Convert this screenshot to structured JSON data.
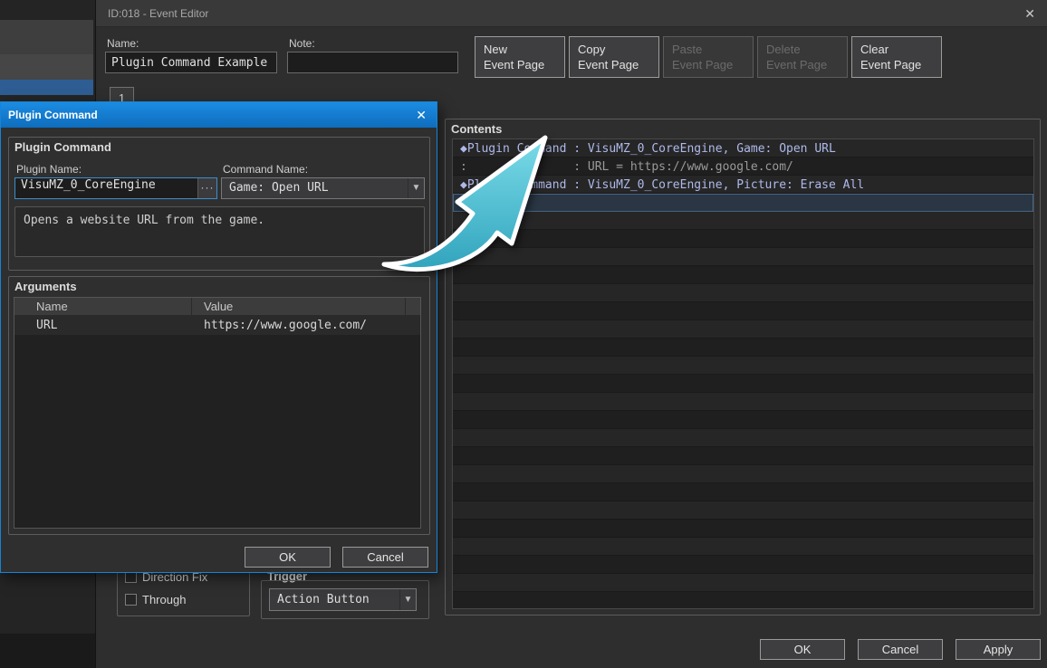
{
  "window": {
    "title": "ID:018 - Event Editor",
    "close_glyph": "✕"
  },
  "header": {
    "name_label": "Name:",
    "name_value": "Plugin Command Example",
    "note_label": "Note:",
    "note_value": "",
    "page_tab": "1",
    "page_buttons": [
      {
        "line1": "New",
        "line2": "Event Page",
        "enabled": true
      },
      {
        "line1": "Copy",
        "line2": "Event Page",
        "enabled": true
      },
      {
        "line1": "Paste",
        "line2": "Event Page",
        "enabled": false
      },
      {
        "line1": "Delete",
        "line2": "Event Page",
        "enabled": false
      },
      {
        "line1": "Clear",
        "line2": "Event Page",
        "enabled": true
      }
    ]
  },
  "dialog": {
    "title": "Plugin Command",
    "close_glyph": "✕",
    "plugin_group": {
      "title": "Plugin Command",
      "plugin_name_label": "Plugin Name:",
      "plugin_name_value": "VisuMZ_0_CoreEngine",
      "browse_glyph": "···",
      "command_name_label": "Command Name:",
      "command_name_value": "Game: Open URL",
      "dropdown_glyph": "▼",
      "description": "Opens a website URL from the game."
    },
    "arguments_group": {
      "title": "Arguments",
      "col_name": "Name",
      "col_value": "Value",
      "rows": [
        {
          "name": "URL",
          "value": "https://www.google.com/"
        }
      ]
    },
    "ok_label": "OK",
    "cancel_label": "Cancel"
  },
  "contents": {
    "title": "Contents",
    "row_count": 26,
    "lines": [
      {
        "row": 0,
        "kind": "plugin",
        "text": "◆Plugin Command : VisuMZ_0_CoreEngine, Game: Open URL"
      },
      {
        "row": 1,
        "kind": "continuation",
        "text": ":               : URL = https://www.google.com/"
      },
      {
        "row": 2,
        "kind": "plugin",
        "text": "◆Plugin Command : VisuMZ_0_CoreEngine, Picture: Erase All"
      },
      {
        "row": 3,
        "kind": "cursor",
        "text": "◆",
        "selected": true
      }
    ]
  },
  "event_page": {
    "checkboxes": [
      {
        "label": "Direction Fix",
        "checked": false
      },
      {
        "label": "Through",
        "checked": false
      }
    ],
    "trigger_label": "Trigger",
    "trigger_value": "Action Button",
    "dropdown_glyph": "▼"
  },
  "footer": {
    "ok_label": "OK",
    "cancel_label": "Cancel",
    "apply_label": "Apply"
  },
  "colors": {
    "accent_blue": "#1584d8",
    "arrow_teal": "#3fb6c9",
    "plugin_text": "#aeb9ea"
  }
}
